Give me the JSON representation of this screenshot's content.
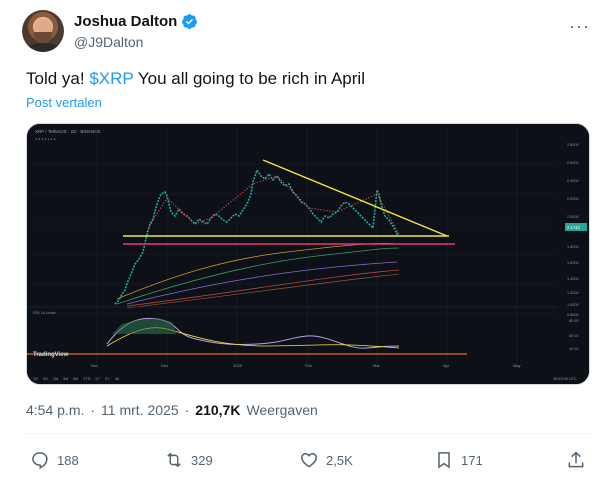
{
  "author": {
    "name": "Joshua Dalton",
    "handle": "@J9Dalton"
  },
  "tweet": {
    "text_before": "Told ya! ",
    "cashtag": "$XRP",
    "text_after": " You all going to be rich in April",
    "translate_label": "Post vertalen"
  },
  "chart_image": {
    "header_symbol": "XRP / TetherUS · 1D · BINANCE",
    "price_label": "2.1742",
    "indicator_label": "RSI 14 close",
    "watermark": "TradingView",
    "x_labels": [
      "Nov",
      "Dec",
      "2025",
      "Feb",
      "Mar",
      "Apr",
      "May"
    ],
    "y_labels": [
      "2.8000",
      "2.6000",
      "2.4000",
      "2.2000",
      "2.0000",
      "1.8000",
      "1.6000",
      "1.4000",
      "1.2000",
      "1.0000",
      "0.8000"
    ],
    "rsi_labels": [
      "80.00",
      "60.00",
      "40.00"
    ],
    "timeframes": [
      "1D",
      "5D",
      "1M",
      "3M",
      "6M",
      "YTD",
      "1Y",
      "5Y",
      "All"
    ],
    "clock": "15:53:08 UTC"
  },
  "meta": {
    "time": "4:54 p.m.",
    "sep1": "·",
    "date": "11 mrt. 2025",
    "sep2": "·",
    "views_count": "210,7K",
    "views_label": "Weergaven"
  },
  "actions": {
    "replies": "188",
    "reposts": "329",
    "likes": "2,5K",
    "bookmarks": "171"
  },
  "colors": {
    "accent": "#1d9bf0",
    "text": "#0f1419",
    "muted": "#536471",
    "chart_bg": "#0d1017",
    "trendline": "#f5e642",
    "support_line": "#e23a6b"
  }
}
